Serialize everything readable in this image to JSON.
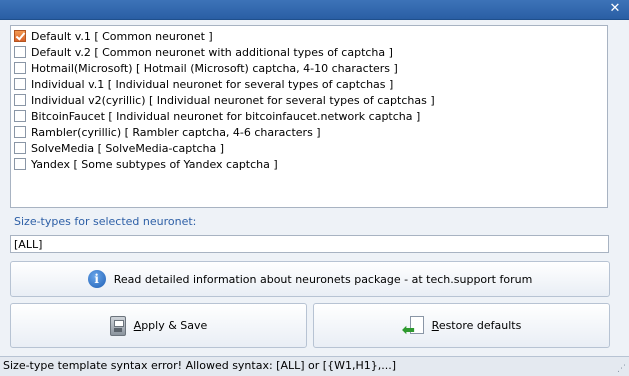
{
  "window": {
    "close_symbol": "✕"
  },
  "neuronets": [
    {
      "label": "Default v.1 [ Common neuronet ]",
      "checked": true
    },
    {
      "label": "Default v.2 [ Common neuronet with additional types of captcha ]",
      "checked": false
    },
    {
      "label": "Hotmail(Microsoft) [ Hotmail (Microsoft) captcha, 4-10 characters ]",
      "checked": false
    },
    {
      "label": "Individual v.1 [ Individual neuronet for several types of captchas ]",
      "checked": false
    },
    {
      "label": "Individual v2(cyrillic) [ Individual neuronet for several types of captchas ]",
      "checked": false
    },
    {
      "label": "BitcoinFaucet [ Individual neuronet for bitcoinfaucet.network captcha ]",
      "checked": false
    },
    {
      "label": "Rambler(cyrillic) [ Rambler captcha, 4-6 characters ]",
      "checked": false
    },
    {
      "label": "SolveMedia [ SolveMedia-captcha ]",
      "checked": false
    },
    {
      "label": "Yandex [ Some subtypes of Yandex captcha ]",
      "checked": false
    }
  ],
  "size_types": {
    "label": "Size-types for selected neuronet:",
    "value": "[ALL]"
  },
  "buttons": {
    "info": "Read detailed information about neuronets package - at tech.support forum",
    "apply_first": "A",
    "apply_rest": "pply & Save",
    "restore_first": "R",
    "restore_rest": "estore defaults"
  },
  "status": {
    "text": "Size-type template syntax error! Allowed syntax: [ALL] or [{W1,H1},...]"
  },
  "icons": {
    "close": "close-icon",
    "info": "info-icon",
    "save": "save-disk-icon",
    "restore": "restore-arrow-icon",
    "grip": "resize-grip-icon"
  },
  "colors": {
    "titlebar": "#2a5ea4",
    "label_blue": "#2d5fa6",
    "checkbox_checked": "#d8612a"
  }
}
